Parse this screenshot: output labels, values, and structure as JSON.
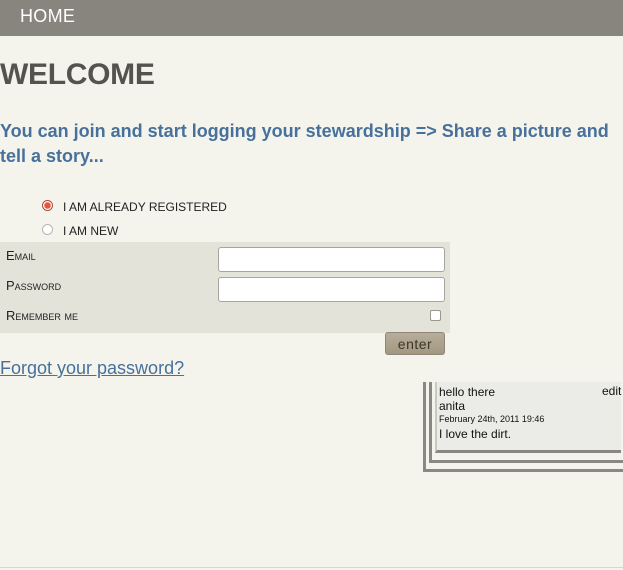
{
  "nav": {
    "home_label": "HOME"
  },
  "page": {
    "title": "WELCOME",
    "tagline": "You can join and start logging your stewardship => Share a picture and tell a story..."
  },
  "login_mode": {
    "selected": "registered",
    "options": [
      {
        "id": "registered",
        "label": "I AM ALREADY REGISTERED"
      },
      {
        "id": "new",
        "label": "I AM NEW"
      }
    ]
  },
  "form": {
    "email_label": "Email",
    "email_value": "",
    "password_label": "Password",
    "password_value": "",
    "remember_label": "Remember me",
    "remember_checked": false,
    "submit_label": "enter"
  },
  "forgot_link": "Forgot your password?",
  "note": {
    "title": "hello there",
    "edit_label": "edit",
    "author": "anita",
    "date": "February 24th, 2011 19:46",
    "body": "I love the dirt."
  },
  "colors": {
    "nav_bg": "#87857e",
    "page_bg": "#f4f3ec",
    "accent_blue": "#47719b",
    "radio_selected": "#e6553d"
  }
}
